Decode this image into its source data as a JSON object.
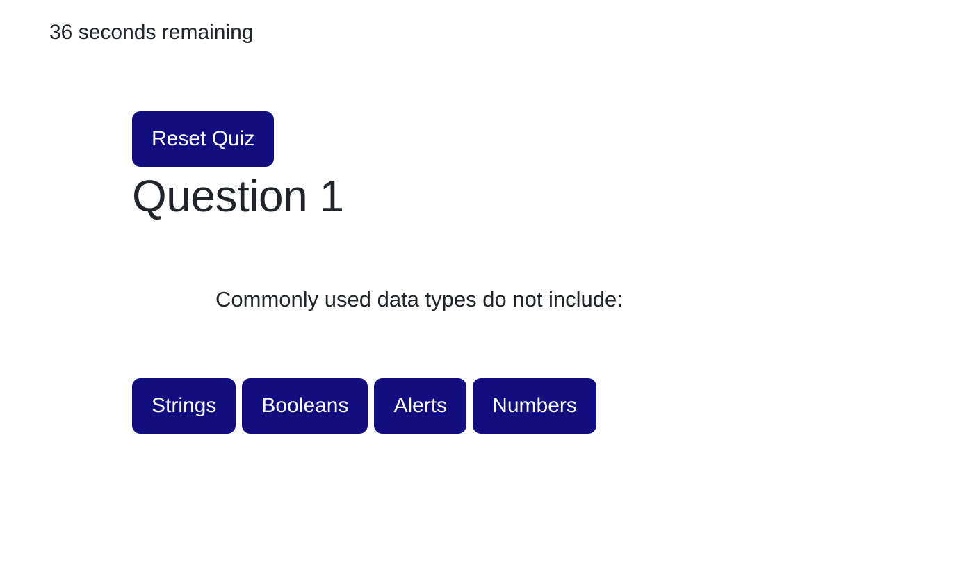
{
  "timer": {
    "text": "36 seconds remaining"
  },
  "quiz": {
    "reset_label": "Reset Quiz",
    "question_title": "Question 1",
    "question_text": "Commonly used data types do not include:",
    "answers": [
      {
        "label": "Strings"
      },
      {
        "label": "Booleans"
      },
      {
        "label": "Alerts"
      },
      {
        "label": "Numbers"
      }
    ]
  },
  "colors": {
    "button_background": "#130e7f",
    "button_text": "#ffffff",
    "body_text": "#212529",
    "page_background": "#ffffff"
  }
}
